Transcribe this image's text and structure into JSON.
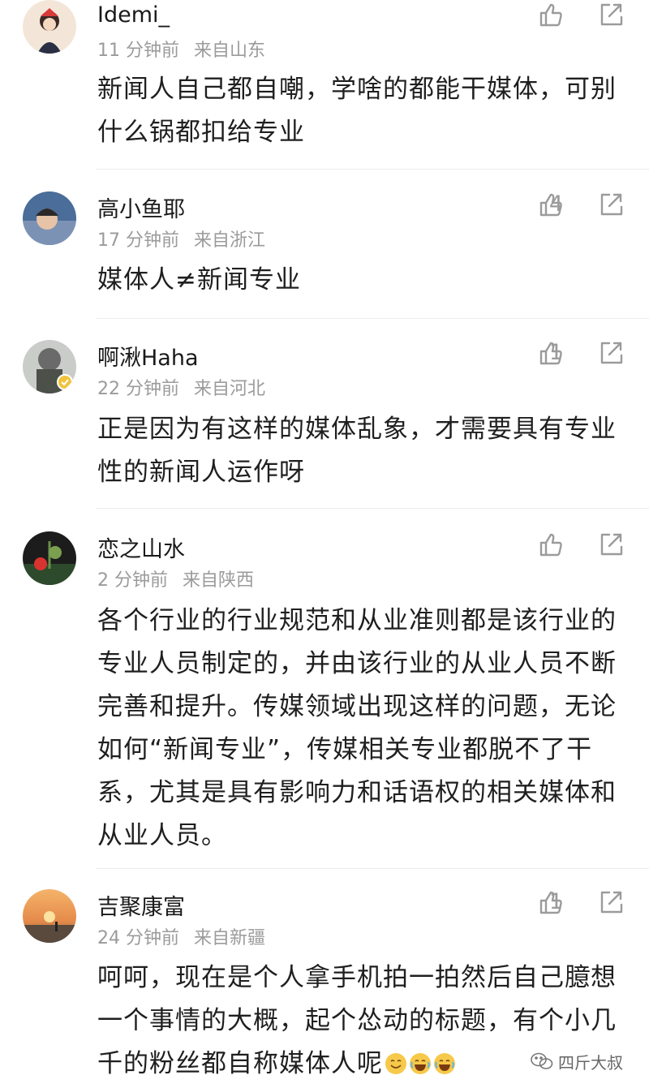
{
  "comments": [
    {
      "username": "Idemi_",
      "time": "11 分钟前",
      "location": "来自山东",
      "likes": "",
      "text": "新闻人自己都自嘲，学啥的都能干媒体，可别什么锅都扣给专业"
    },
    {
      "username": "高小鱼耶",
      "time": "17 分钟前",
      "location": "来自浙江",
      "likes": "4",
      "text": "媒体人≠新闻专业"
    },
    {
      "username": "啊湫Haha",
      "time": "22 分钟前",
      "location": "来自河北",
      "likes": "1",
      "text": "正是因为有这样的媒体乱象，才需要具有专业性的新闻人运作呀"
    },
    {
      "username": "恋之山水",
      "time": "2 分钟前",
      "location": "来自陕西",
      "likes": "",
      "text": "各个行业的行业规范和从业准则都是该行业的专业人员制定的，并由该行业的从业人员不断完善和提升。传媒领域出现这样的问题，无论如何“新闻专业”，传媒相关专业都脱不了干系，尤其是具有影响力和话语权的相关媒体和从业人员。"
    },
    {
      "username": "吉聚康富",
      "time": "24 分钟前",
      "location": "来自新疆",
      "likes": "1",
      "text": "呵呵，现在是个人拿手机拍一拍然后自己臆想一个事情的大概，起个怂动的标题，有个小几千的粉丝都自称媒体人呢"
    }
  ],
  "watermark": "四斤大叔",
  "icons": {
    "like": "thumb-up-icon",
    "share": "share-icon",
    "emoji": "laughing-crying-emoji-icon",
    "watermark_logo": "wechat-logo-icon"
  },
  "colors": {
    "text": "#1f1f1f",
    "meta": "#9b9b9b",
    "icon": "#9b9b9b",
    "divider": "#ececec"
  }
}
